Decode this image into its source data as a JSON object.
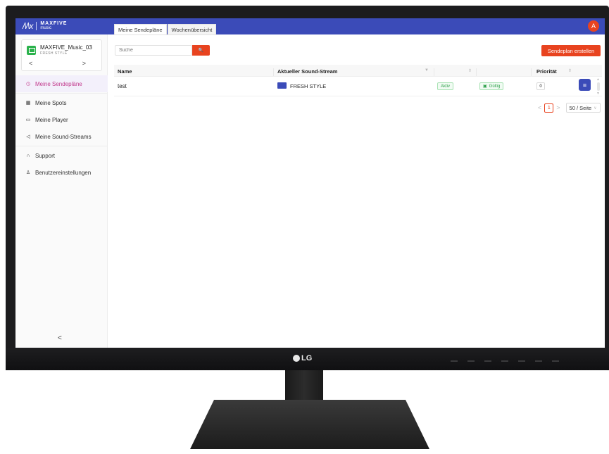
{
  "brand": {
    "mark": "/\\/\\x",
    "line1": "MAXFIVE",
    "line2": "music"
  },
  "user": {
    "avatar_letter": "A"
  },
  "player": {
    "name": "MAXFIVE_Music_03",
    "stream": "FRESH STYLE",
    "prev": "<",
    "next": ">"
  },
  "nav": [
    {
      "label": "Meine Sendepläne",
      "icon": "◷"
    },
    {
      "label": "Meine Spots",
      "icon": "▦"
    },
    {
      "label": "Meine Player",
      "icon": "▭"
    },
    {
      "label": "Meine Sound-Streams",
      "icon": "◁"
    },
    {
      "label": "Support",
      "icon": "∩"
    },
    {
      "label": "Benutzereinstellungen",
      "icon": "♙"
    }
  ],
  "sidebar": {
    "collapse": "<"
  },
  "tabs": [
    {
      "label": "Meine Sendepläne"
    },
    {
      "label": "Wochenübersicht"
    }
  ],
  "search": {
    "placeholder": "Suche",
    "button": "🔍"
  },
  "create_button": "Sendeplan erstellen",
  "table": {
    "headers": {
      "name": "Name",
      "stream": "Aktueller Sound-Stream",
      "priority": "Priorität"
    },
    "rows": [
      {
        "name": "test",
        "stream": "FRESH STYLE",
        "status": "Aktiv",
        "validity": "Gültig",
        "priority": "0",
        "action": "≡"
      }
    ]
  },
  "pagination": {
    "prev": "<",
    "current": "1",
    "next": ">",
    "page_size": "50 / Seite"
  },
  "monitor": {
    "logo": "LG"
  },
  "colors": {
    "primary": "#3b4bb8",
    "accent": "#e8431f",
    "active_nav": "#c2398c",
    "success": "#2ca049"
  }
}
